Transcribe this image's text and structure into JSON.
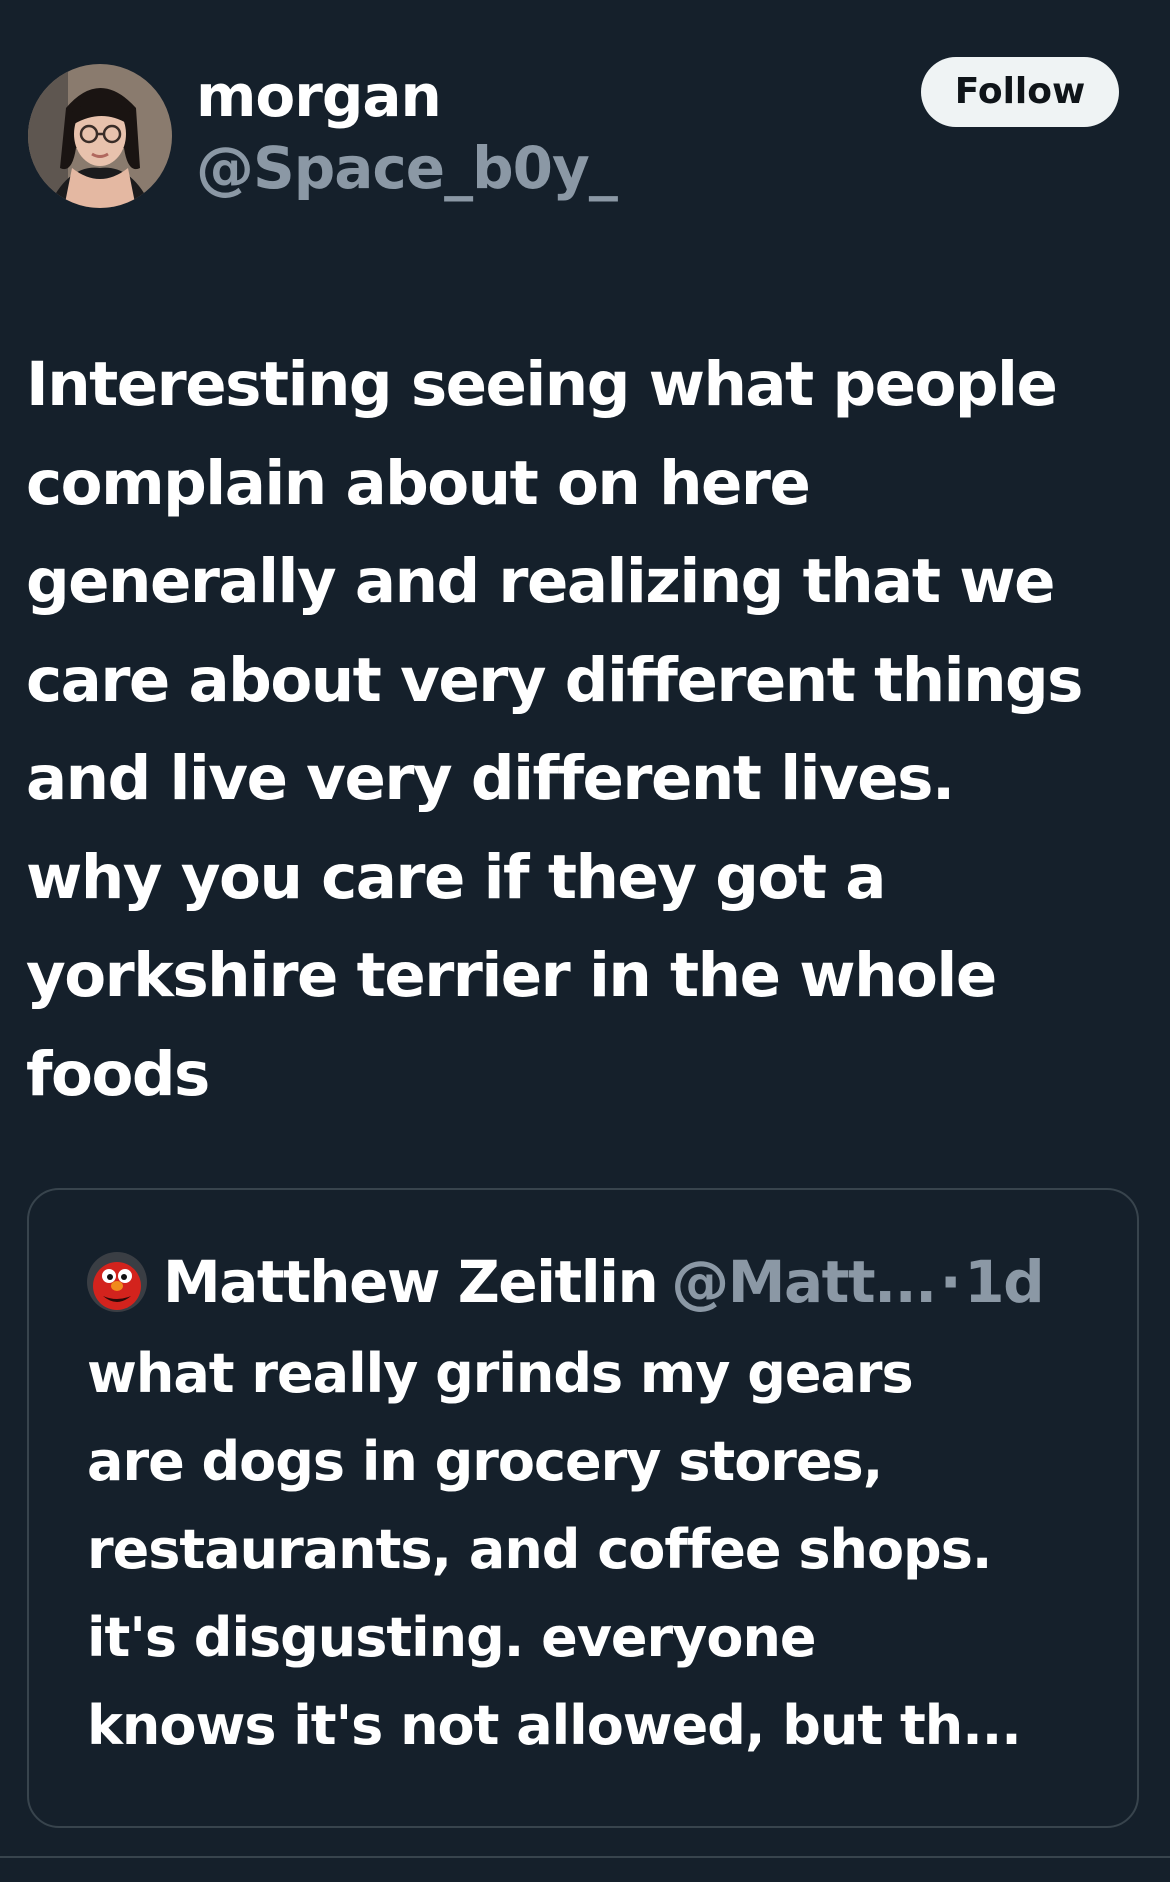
{
  "post": {
    "author": {
      "display_name": "morgan",
      "handle": "@Space_b0y_",
      "avatar_icon": "profile-photo"
    },
    "follow_label": "Follow",
    "text": "Interesting seeing what people\ncomplain about on here\ngenerally and realizing that we\ncare about very different things\nand live very different lives.\nwhy you care if they got a\nyorkshire terrier in the whole\nfoods"
  },
  "quote": {
    "author": {
      "display_name": "Matthew Zeitlin",
      "handle": "@Matt...",
      "avatar_icon": "elmo-avatar"
    },
    "separator": "·",
    "time": "1d",
    "text": "what really grinds my gears\nare dogs in grocery stores,\nrestaurants, and coffee shops.\nit's disgusting. everyone\nknows it's not allowed, but th..."
  },
  "colors": {
    "background": "#15202b",
    "primary_text": "#ffffff",
    "secondary_text": "#8b98a5",
    "border": "#38444d",
    "follow_bg": "#eff3f4",
    "follow_text": "#0f1419"
  }
}
